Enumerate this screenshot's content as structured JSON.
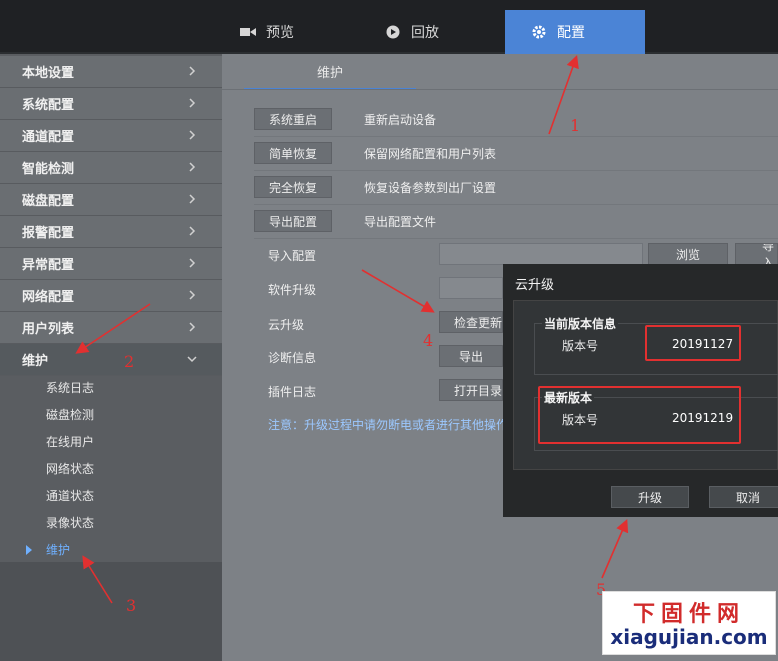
{
  "top_nav": {
    "tabs": [
      {
        "label": "预览",
        "icon": "video-camera-icon"
      },
      {
        "label": "回放",
        "icon": "play-icon"
      },
      {
        "label": "配置",
        "icon": "gear-icon",
        "active": true
      }
    ]
  },
  "sidebar": {
    "items": [
      {
        "label": "本地设置"
      },
      {
        "label": "系统配置"
      },
      {
        "label": "通道配置"
      },
      {
        "label": "智能检测"
      },
      {
        "label": "磁盘配置"
      },
      {
        "label": "报警配置"
      },
      {
        "label": "异常配置"
      },
      {
        "label": "网络配置"
      },
      {
        "label": "用户列表"
      },
      {
        "label": "维护",
        "expanded": true
      }
    ],
    "sub_items": [
      {
        "label": "系统日志"
      },
      {
        "label": "磁盘检测"
      },
      {
        "label": "在线用户"
      },
      {
        "label": "网络状态"
      },
      {
        "label": "通道状态"
      },
      {
        "label": "录像状态"
      },
      {
        "label": "维护",
        "active": true
      }
    ]
  },
  "main": {
    "tab_label": "维护",
    "actions": [
      {
        "button": "系统重启",
        "desc": "重新启动设备"
      },
      {
        "button": "简单恢复",
        "desc": "保留网络配置和用户列表"
      },
      {
        "button": "完全恢复",
        "desc": "恢复设备参数到出厂设置"
      },
      {
        "button": "导出配置",
        "desc": "导出配置文件"
      }
    ],
    "import_label": "导入配置",
    "browse_button": "浏览",
    "import_button": "导入",
    "upgrade_label": "软件升级",
    "cloud_label": "云升级",
    "check_update_button": "检查更新",
    "diag_label": "诊断信息",
    "export_button": "导出",
    "plugin_label": "插件日志",
    "open_dir_button": "打开目录",
    "notice": "注意：升级过程中请勿断电或者进行其他操作"
  },
  "dialog": {
    "title": "云升级",
    "current_section": "当前版本信息",
    "current_label": "版本号",
    "current_version": "20191127",
    "latest_section": "最新版本",
    "latest_label": "版本号",
    "latest_version": "20191219",
    "upgrade_button": "升级",
    "cancel_button": "取消"
  },
  "annotations": [
    "1",
    "2",
    "3",
    "4",
    "5"
  ],
  "watermark": {
    "line1": "下固件网",
    "line2": "xiagujian.com"
  },
  "colors": {
    "accent": "#4b84d6",
    "annotation_red": "#e23030",
    "sidebar_active": "#6fb0ff"
  }
}
